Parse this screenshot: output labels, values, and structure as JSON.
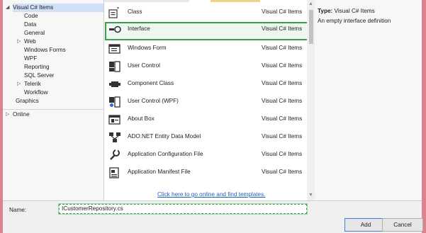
{
  "tree": {
    "root": "Visual C# Items",
    "items": [
      "Code",
      "Data",
      "General",
      "Web",
      "Windows Forms",
      "WPF",
      "Reporting",
      "SQL Server",
      "Telerik",
      "Workflow"
    ],
    "graphics": "Graphics",
    "online": "Online"
  },
  "templates": [
    {
      "name": "Class",
      "lang": "Visual C# Items",
      "icon": "class-icon"
    },
    {
      "name": "Interface",
      "lang": "Visual C# Items",
      "icon": "interface-icon"
    },
    {
      "name": "Windows Form",
      "lang": "Visual C# Items",
      "icon": "windows-form-icon"
    },
    {
      "name": "User Control",
      "lang": "Visual C# Items",
      "icon": "user-control-icon"
    },
    {
      "name": "Component Class",
      "lang": "Visual C# Items",
      "icon": "component-class-icon"
    },
    {
      "name": "User Control (WPF)",
      "lang": "Visual C# Items",
      "icon": "wpf-user-control-icon"
    },
    {
      "name": "About Box",
      "lang": "Visual C# Items",
      "icon": "about-box-icon"
    },
    {
      "name": "ADO.NET Entity Data Model",
      "lang": "Visual C# Items",
      "icon": "entity-model-icon"
    },
    {
      "name": "Application Configuration File",
      "lang": "Visual C# Items",
      "icon": "config-file-icon"
    },
    {
      "name": "Application Manifest File",
      "lang": "Visual C# Items",
      "icon": "manifest-file-icon"
    }
  ],
  "online_link": "Click here to go online and find templates.",
  "info": {
    "type_label": "Type:",
    "type_value": "Visual C# Items",
    "description": "An empty interface definition"
  },
  "name_label": "Name:",
  "name_value": "ICustomerRepository.cs",
  "buttons": {
    "add": "Add",
    "cancel": "Cancel"
  },
  "colors": {
    "selection_border": "#3aa04b",
    "link": "#1f5fbf",
    "frame": "#d9858f"
  }
}
